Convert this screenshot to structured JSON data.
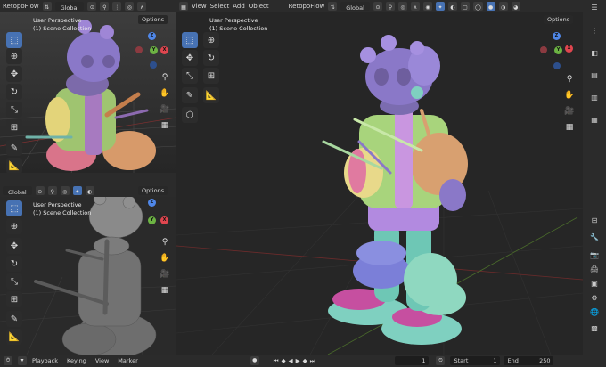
{
  "colors": {
    "accent": "#4772b3",
    "axis_x": "#e0464f",
    "axis_y": "#6cb343",
    "axis_z": "#4f87e8"
  },
  "top_left_header": {
    "addon": "RetopoFlow",
    "orientation": "Global",
    "options": "Options"
  },
  "main_header": {
    "menu": [
      "View",
      "Select",
      "Add",
      "Object"
    ],
    "addon": "RetopoFlow",
    "orientation": "Global",
    "options": "Options"
  },
  "bottom_left_header": {
    "orientation": "Global",
    "options": "Options"
  },
  "viewports": {
    "top_left": {
      "perspective": "User Perspective",
      "collection": "(1) Scene Collection"
    },
    "bottom_left": {
      "perspective": "User Perspective",
      "collection": "(1) Scene Collection"
    },
    "main": {
      "perspective": "User Perspective",
      "collection": "(1) Scene Collection"
    }
  },
  "gizmo_labels": {
    "x": "X",
    "y": "Y",
    "z": "Z"
  },
  "timeline": {
    "menu": [
      "Playback",
      "Keying",
      "View",
      "Marker"
    ],
    "current_frame": "1",
    "start_label": "Start",
    "start": "1",
    "end_label": "End",
    "end": "250"
  }
}
